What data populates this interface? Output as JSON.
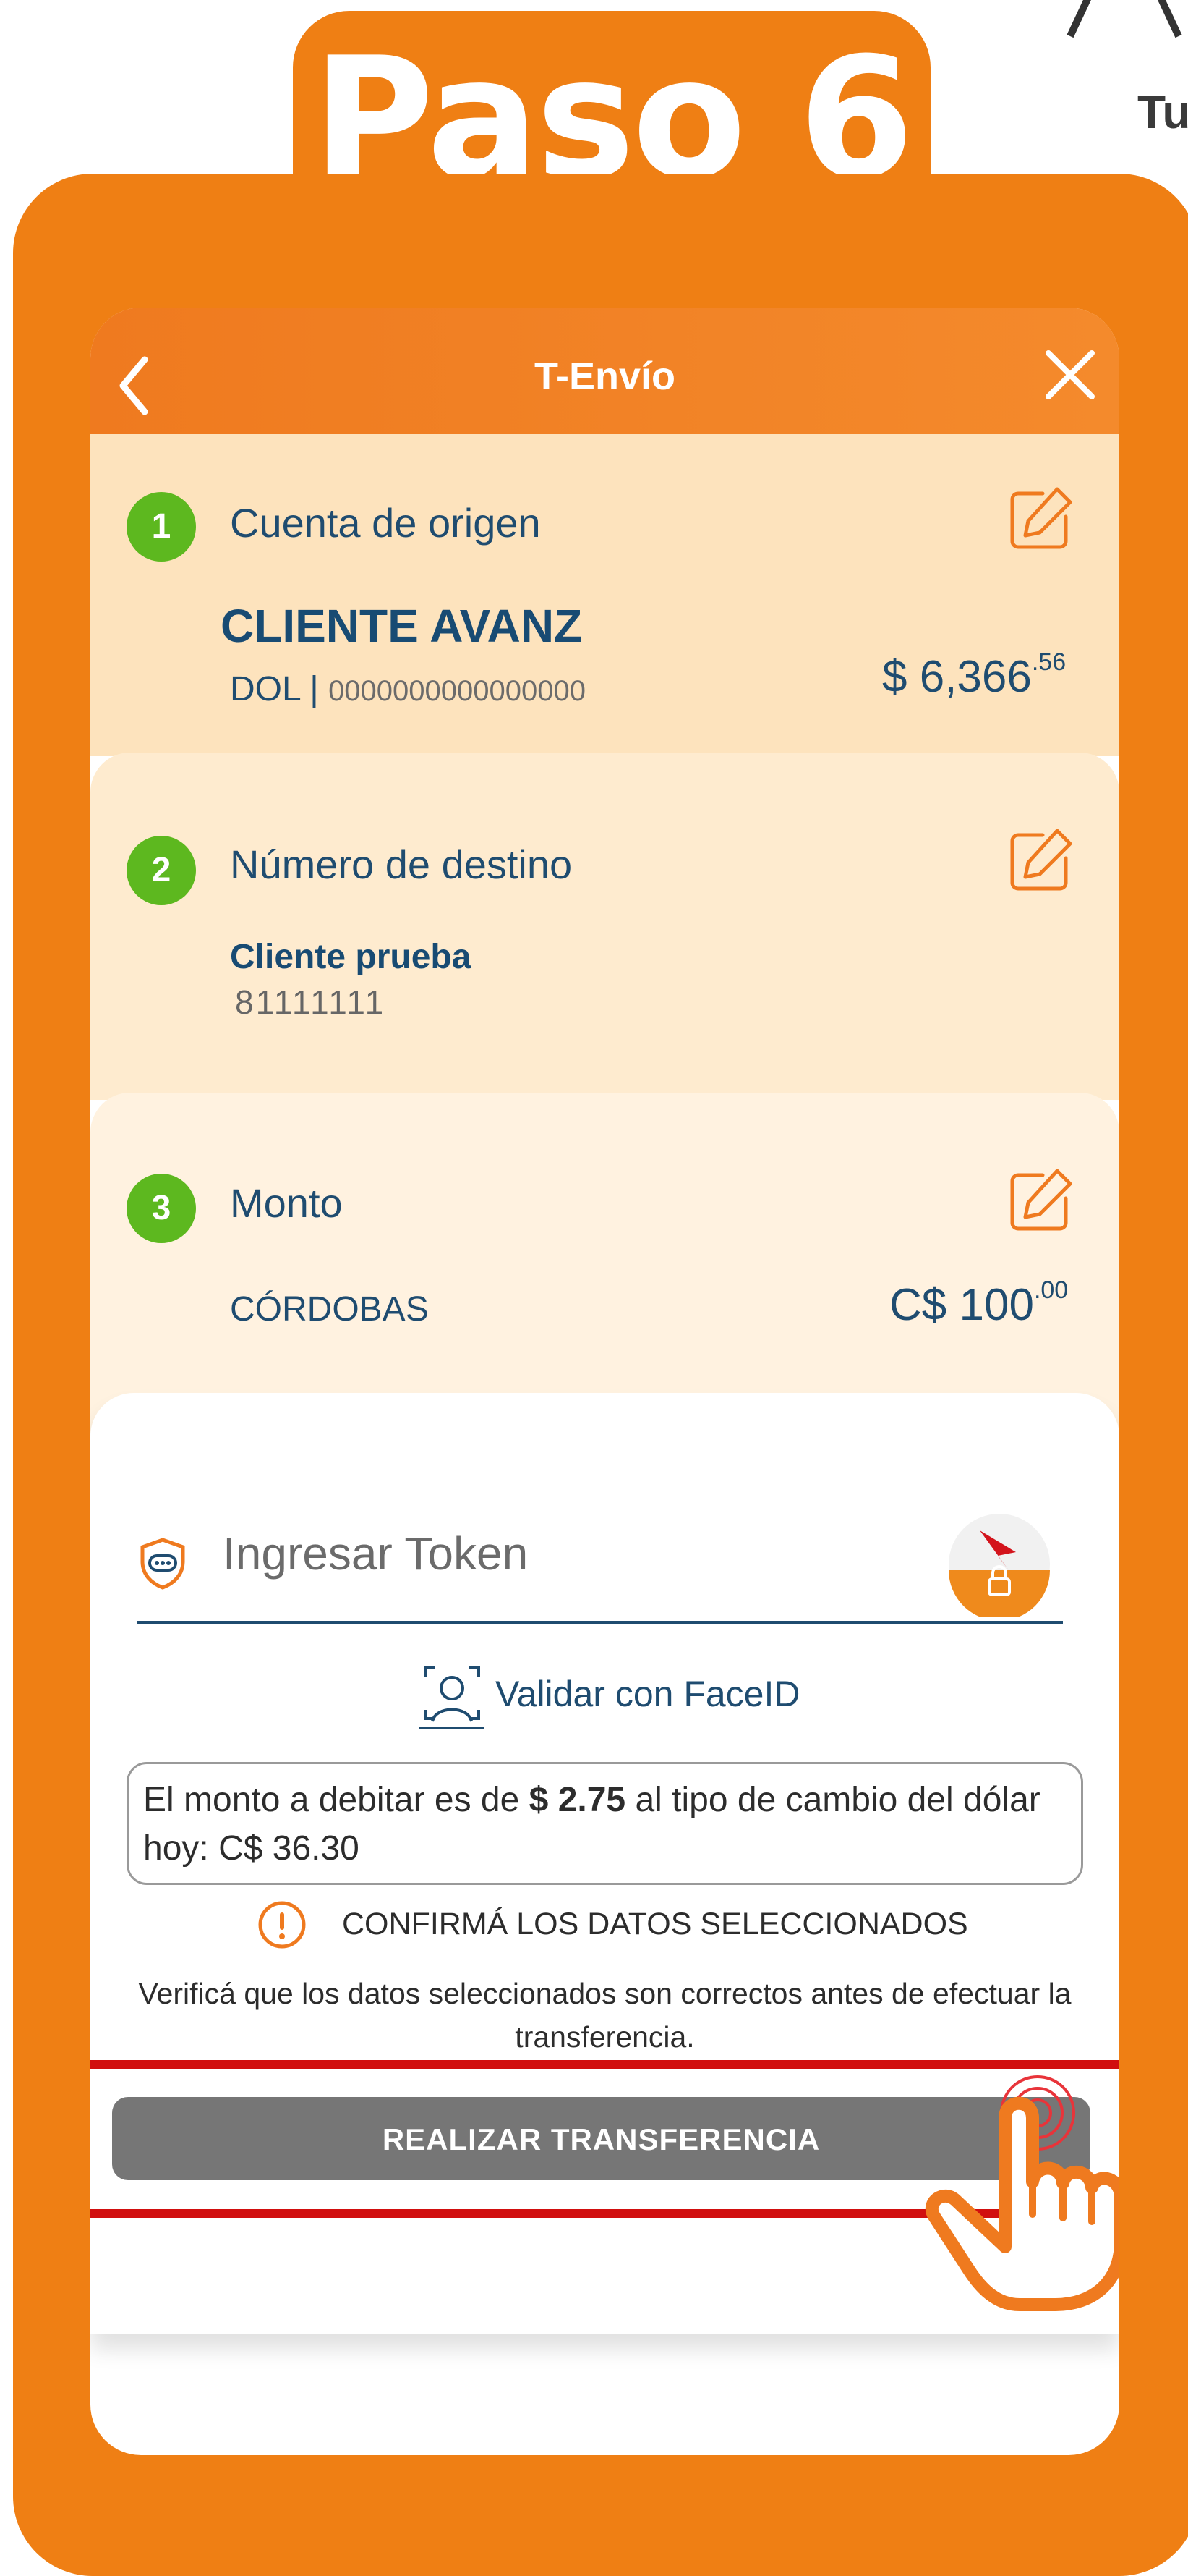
{
  "header": {
    "step_title": "Paso 6",
    "corner_brand_text": "Tu"
  },
  "app": {
    "title": "T-Envío"
  },
  "origin": {
    "step_number": "1",
    "label": "Cuenta de origen",
    "client_name": "CLIENTE AVANZ",
    "currency": "DOL |",
    "account_number": "0000000000000000",
    "balance_main": "$ 6,366",
    "balance_cents": ".56"
  },
  "destination": {
    "step_number": "2",
    "label": "Número de destino",
    "name": "Cliente prueba",
    "number": "81111111"
  },
  "amount": {
    "step_number": "3",
    "label": "Monto",
    "currency_name": "CÓRDOBAS",
    "value_main": "C$ 100",
    "value_cents": ".00"
  },
  "token": {
    "placeholder": "Ingresar Token",
    "faceid_label": "Validar con FaceID"
  },
  "info": {
    "debit_prefix": "El monto a debitar es de ",
    "debit_amount": "$ 2.75",
    "debit_suffix": " al tipo de cambio del dólar hoy: C$ 36.30"
  },
  "confirm": {
    "title": "CONFIRMÁ LOS DATOS SELECCIONADOS",
    "description": "Verificá que los datos seleccionados son correctos antes de efectuar la transferencia."
  },
  "actions": {
    "transfer_label": "REALIZAR TRANSFERENCIA"
  },
  "colors": {
    "brand_orange": "#ef7f14",
    "step_green": "#5db81f",
    "text_blue": "#1f4c70",
    "highlight_red": "#d10f0f",
    "button_gray": "#767676"
  },
  "icons": {
    "back": "chevron-left-icon",
    "close": "close-icon",
    "edit": "edit-icon",
    "shield": "shield-icon",
    "token_app": "token-app-icon",
    "faceid": "faceid-icon",
    "warning": "warning-icon",
    "hand": "pointing-hand-icon"
  }
}
